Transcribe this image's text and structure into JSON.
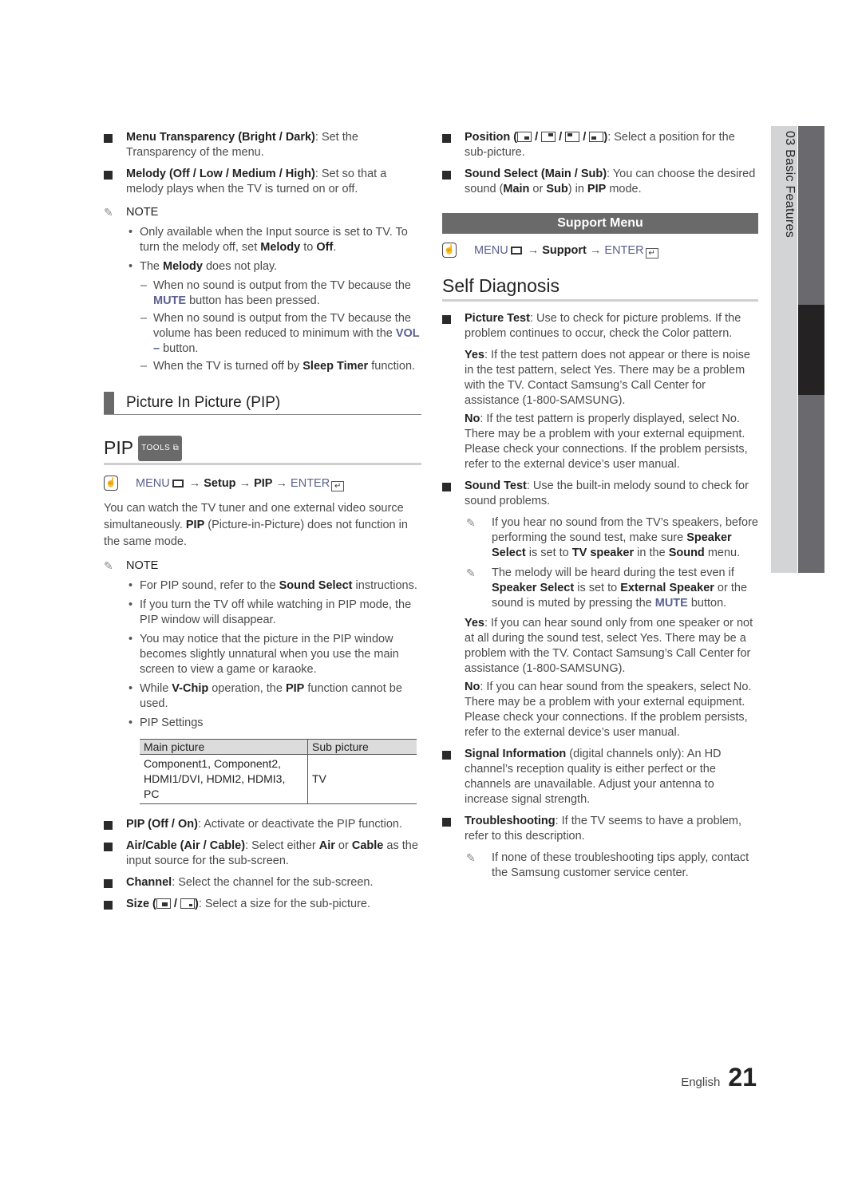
{
  "left": {
    "menu_transparency": {
      "bold": "Menu Transparency (Bright / Dark)",
      "text": ": Set the Transparency of the menu."
    },
    "melody": {
      "bold": "Melody (Off / Low / Medium / High)",
      "text": ": Set so that a melody plays when the TV is turned on or off."
    },
    "note1_label": "NOTE",
    "note1_b1_a": "Only available when the Input source is set to TV. To turn the melody off, set ",
    "note1_b1_melody": "Melody",
    "note1_b1_to": " to ",
    "note1_b1_off": "Off",
    "note1_b1_end": ".",
    "note1_b2_a": "The ",
    "note1_b2_melody": "Melody",
    "note1_b2_b": " does not play.",
    "dash1_a": "When no sound is output from the TV because the ",
    "dash1_mute": "MUTE",
    "dash1_b": " button has been pressed.",
    "dash2_a": "When no sound is output from the TV because the volume has been reduced to minimum with the ",
    "dash2_vol": "VOL –",
    "dash2_b": " button.",
    "dash3_a": "When the TV is turned off by ",
    "dash3_sleep": "Sleep Timer",
    "dash3_b": " function.",
    "section_title": "Picture In Picture (PIP)",
    "pip_title": "PIP",
    "tools_badge": "TOOLS",
    "menu_path": {
      "menu": "MENU",
      "arrow1": " → ",
      "setup": "Setup",
      "arrow2": " → ",
      "pip": "PIP",
      "arrow3": " → ",
      "enter": "ENTER"
    },
    "intro_a": "You can watch the TV tuner and one external video source simultaneously. ",
    "intro_pip": "PIP",
    "intro_b": " (Picture-in-Picture) does not function in the same mode.",
    "note2_label": "NOTE",
    "note2_b1_a": "For PIP sound, refer to the ",
    "note2_b1_bold": "Sound Select",
    "note2_b1_b": " instructions.",
    "note2_b2": "If you turn the TV off while watching in PIP mode, the PIP window will disappear.",
    "note2_b3": "You may notice that the picture in the PIP window becomes slightly unnatural when you use the main screen to view a game or karaoke.",
    "note2_b4_a": "While ",
    "note2_b4_vchip": "V-Chip",
    "note2_b4_b": " operation, the ",
    "note2_b4_pip": "PIP",
    "note2_b4_c": " function cannot be used.",
    "note2_b5": "PIP Settings",
    "table": {
      "headers": [
        "Main picture",
        "Sub picture"
      ],
      "main": "Component1, Component2, HDMI1/DVI, HDMI2, HDMI3, PC",
      "sub": "TV"
    },
    "pip_onoff": {
      "bold": "PIP (Off / On)",
      "text": ": Activate or deactivate the PIP function."
    },
    "aircable": {
      "bold": "Air/Cable (Air / Cable)",
      "text_a": ": Select either ",
      "air": "Air",
      "or": " or ",
      "cable": "Cable",
      "text_b": " as the input source for the sub-screen."
    },
    "channel": {
      "bold": "Channel",
      "text": ": Select the channel for the sub-screen."
    },
    "size": {
      "bold_a": "Size (",
      "slash": " / ",
      "bold_b": ")",
      "text": ": Select a size for the sub-picture."
    }
  },
  "right": {
    "position": {
      "bold_a": "Position (",
      "slash": " / ",
      "bold_b": ")",
      "text": ": Select a position for the sub-picture."
    },
    "sound_select": {
      "bold": "Sound Select (Main / Sub)",
      "text_a": ": You can choose the desired sound (",
      "main": "Main",
      "or": " or ",
      "sub": "Sub",
      "text_b": ") in ",
      "pip": "PIP",
      "text_c": " mode."
    },
    "support_menu": "Support Menu",
    "menu_path": {
      "menu": "MENU",
      "arrow1": " → ",
      "support": "Support",
      "arrow2": " → ",
      "enter": "ENTER"
    },
    "self_diag_title": "Self Diagnosis",
    "picture_test": {
      "bold": "Picture Test",
      "text": ": Use to check for picture problems. If the problem continues to occur, check the Color pattern."
    },
    "pt_yes_bold": "Yes",
    "pt_yes": ": If the test pattern does not appear or there is noise in the test pattern, select Yes. There may be a problem with the TV. Contact Samsung’s Call Center for assistance (1-800-SAMSUNG).",
    "pt_no_bold": "No",
    "pt_no": ": If the test pattern is properly displayed, select No. There may be a problem with your external equipment. Please check your connections. If the problem persists, refer to the external device’s user manual.",
    "sound_test": {
      "bold": "Sound Test",
      "text": ": Use the built-in melody sound to check for sound problems."
    },
    "st_note1_a": "If you hear no sound from the TV’s speakers, before performing the sound test, make sure ",
    "st_note1_ss": "Speaker Select",
    "st_note1_b": " is set to ",
    "st_note1_tv": "TV speaker",
    "st_note1_c": " in the ",
    "st_note1_sound": "Sound",
    "st_note1_d": " menu.",
    "st_note2_a": "The melody will be heard during the test even if ",
    "st_note2_ss": "Speaker Select",
    "st_note2_b": " is set to ",
    "st_note2_ext": "External Speaker",
    "st_note2_c": " or the sound is muted by pressing the ",
    "st_note2_mute": "MUTE",
    "st_note2_d": " button.",
    "st_yes_bold": "Yes",
    "st_yes": ": If you can hear sound only from one speaker or not at all during the sound test, select Yes. There may be a problem with the TV. Contact Samsung’s Call Center for assistance (1-800-SAMSUNG).",
    "st_no_bold": "No",
    "st_no": ": If you can hear sound from the speakers, select No. There may be a problem with your external equipment. Please check your connections. If the problem persists, refer to the external device’s user manual.",
    "signal_info": {
      "bold": "Signal Information",
      "text": " (digital channels only): An HD channel’s reception quality is either perfect or the channels are unavailable. Adjust your antenna to increase signal strength."
    },
    "troubleshooting": {
      "bold": "Troubleshooting",
      "text": ": If the TV seems to have a problem, refer to this description."
    },
    "ts_note": "If none of these troubleshooting tips apply, contact the Samsung customer service center."
  },
  "side_tab": {
    "chapter": "03  Basic Features"
  },
  "footer": {
    "language": "English",
    "page": "21"
  }
}
